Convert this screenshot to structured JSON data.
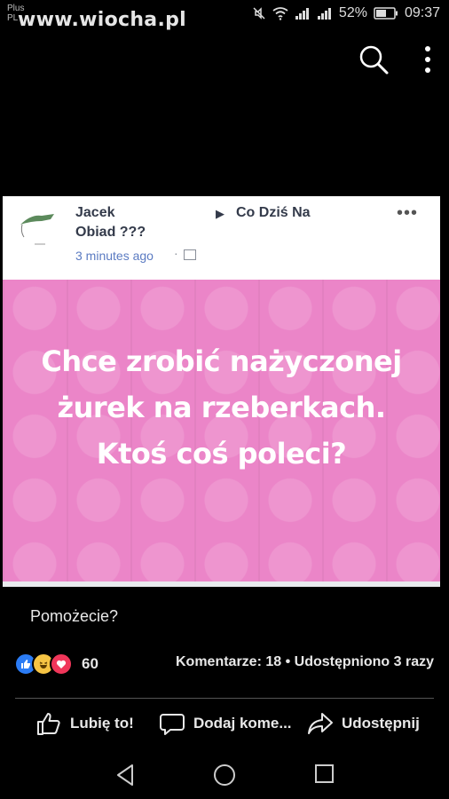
{
  "status_bar": {
    "carrier": "Plus",
    "carrier_sub": "PL",
    "watermark": "www.wiocha.pl",
    "battery": "52%",
    "time": "09:37"
  },
  "post": {
    "author": "Jacek",
    "group_arrow": "▶",
    "group": "Co Dziś Na",
    "group_cont": "Obiad ???",
    "time": "3 minutes ago",
    "time_sep": "·",
    "more": "•••",
    "image_text": "Chce zrobić nażyczonej żurek na rzeberkach. Ktoś coś poleci?"
  },
  "caption": "Pomożecie?",
  "reactions": {
    "count": "60",
    "stats": "Komentarze: 18 • Udostępniono 3 razy"
  },
  "actions": {
    "like": "Lubię to!",
    "comment": "Dodaj kome...",
    "share": "Udostępnij"
  },
  "colors": {
    "pink_background": "#eb85c8",
    "link_blue": "#5b7bc2",
    "like_blue": "#2b7cf5"
  }
}
